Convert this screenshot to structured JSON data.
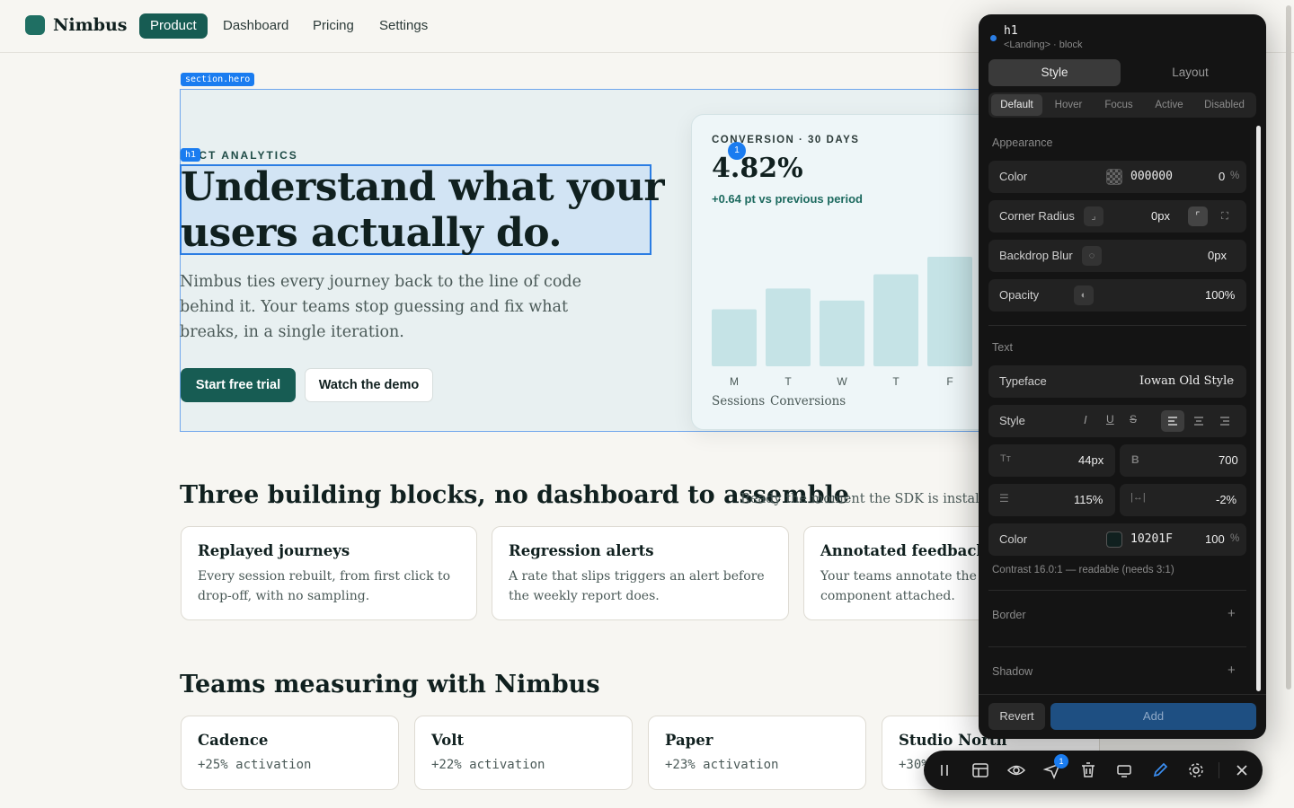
{
  "nav": {
    "brand": "Nimbus",
    "items": [
      {
        "label": "Product",
        "active": true
      },
      {
        "label": "Dashboard",
        "active": false
      },
      {
        "label": "Pricing",
        "active": false
      },
      {
        "label": "Settings",
        "active": false
      }
    ]
  },
  "selection": {
    "section_tag": "section.hero",
    "element_tag": "h1",
    "pin_number": "1"
  },
  "hero": {
    "eyebrow": "DUCT ANALYTICS",
    "headline": "Understand what your users actually do.",
    "lede": "Nimbus ties every journey back to the line of code behind it. Your teams stop guessing and fix what breaks, in a single iteration.",
    "primary_cta": "Start free trial",
    "secondary_cta": "Watch the demo"
  },
  "chart_card": {
    "label": "CONVERSION · 30 DAYS",
    "value": "4.82%",
    "delta": "+0.64 pt vs previous period",
    "legend": [
      "Sessions",
      "Conversions"
    ]
  },
  "chart_data": {
    "type": "bar",
    "categories": [
      "M",
      "T",
      "W",
      "T",
      "F"
    ],
    "values": [
      0.52,
      0.71,
      0.6,
      0.84,
      1.0
    ],
    "ylim": [
      0,
      1
    ],
    "color": "#c5e3e6"
  },
  "blocks": {
    "title": "Three building blocks, no dashboard to assemble",
    "subtitle": "Ready the moment the SDK is installed.",
    "cards": [
      {
        "title": "Replayed journeys",
        "body": "Every session rebuilt, from first click to drop-off, with no sampling."
      },
      {
        "title": "Regression alerts",
        "body": "A rate that slips triggers an alert before the weekly report does."
      },
      {
        "title": "Annotated feedback",
        "body": "Your teams annotate the UI; with the component attached."
      }
    ]
  },
  "teams": {
    "title": "Teams measuring with Nimbus",
    "cards": [
      {
        "name": "Cadence",
        "metric": "+25% activation"
      },
      {
        "name": "Volt",
        "metric": "+22% activation"
      },
      {
        "name": "Paper",
        "metric": "+23% activation"
      },
      {
        "name": "Studio North",
        "metric": "+30%"
      }
    ]
  },
  "inspector": {
    "tag": "h1",
    "subtitle": "<Landing> · block",
    "tabs": [
      "Style",
      "Layout"
    ],
    "states": [
      "Default",
      "Hover",
      "Focus",
      "Active",
      "Disabled"
    ],
    "appearance": {
      "label": "Appearance",
      "color_label": "Color",
      "color_hex": "000000",
      "color_opacity": "0",
      "percent": "%",
      "radius_label": "Corner Radius",
      "radius_value": "0px",
      "blur_label": "Backdrop Blur",
      "blur_value": "0px",
      "opacity_label": "Opacity",
      "opacity_value": "100%"
    },
    "text": {
      "label": "Text",
      "typeface_label": "Typeface",
      "typeface_value": "Iowan Old Style",
      "style_label": "Style",
      "size": "44px",
      "weight": "700",
      "line_height": "115%",
      "letter_spacing": "-2%",
      "color_label": "Color",
      "color_hex": "10201F",
      "color_opacity": "100",
      "swatch": "#10201f",
      "contrast": "Contrast 16.0:1 — readable (needs 3:1)"
    },
    "border_label": "Border",
    "shadow_label": "Shadow",
    "revert": "Revert",
    "add": "Add"
  },
  "toolbar": {
    "badge": "1"
  }
}
